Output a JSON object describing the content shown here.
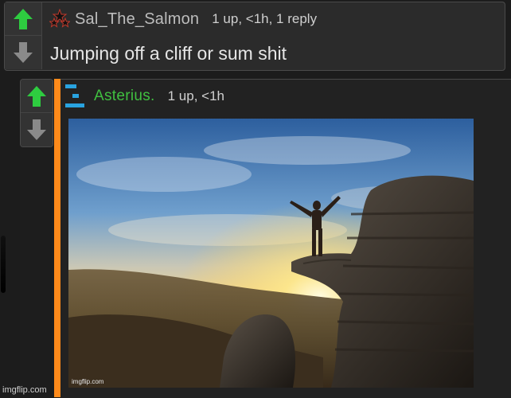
{
  "comment_parent": {
    "username": "Sal_The_Salmon",
    "meta": "1 up, <1h, 1 reply",
    "text": "Jumping off a cliff or sum shit"
  },
  "comment_reply": {
    "username": "Asterius.",
    "meta": "1 up, <1h",
    "image_watermark": "imgflip.com"
  },
  "footer_watermark": "imgflip.com",
  "icons": {
    "upvote": "upvote-arrow-icon",
    "downvote": "downvote-arrow-icon",
    "avatar_parent": "stars-avatar-icon",
    "avatar_reply": "blue-bars-avatar-icon"
  },
  "colors": {
    "upvote_active": "#2ecc40",
    "downvote": "#8a8a8a",
    "reply_username": "#40c040",
    "thread_bar": "#ff8a1a"
  }
}
